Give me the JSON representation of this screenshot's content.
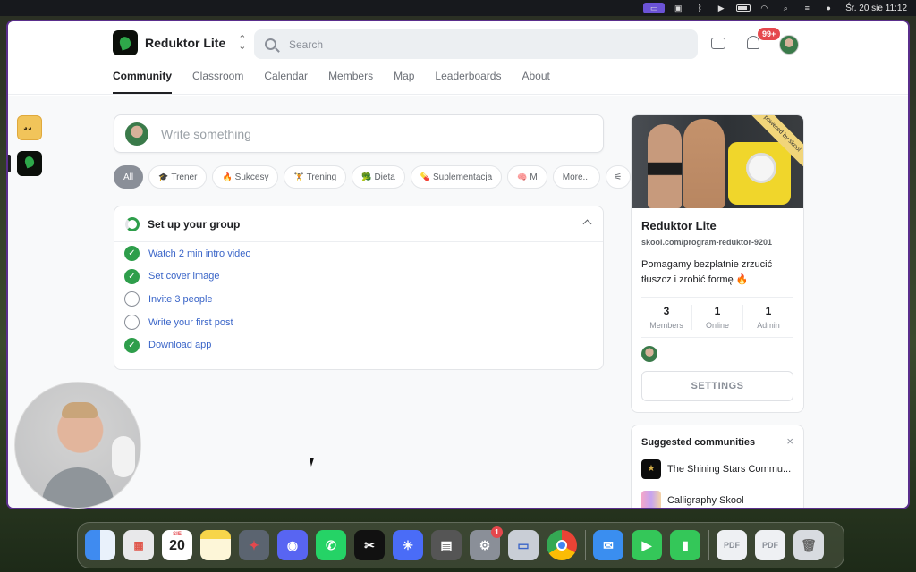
{
  "menubar": {
    "date_time": "Śr. 20 sie  11:12"
  },
  "header": {
    "group_name": "Reduktor Lite",
    "search_placeholder": "Search",
    "notification_count": "99+",
    "tabs": [
      {
        "label": "Community",
        "active": true
      },
      {
        "label": "Classroom",
        "active": false
      },
      {
        "label": "Calendar",
        "active": false
      },
      {
        "label": "Members",
        "active": false
      },
      {
        "label": "Map",
        "active": false
      },
      {
        "label": "Leaderboards",
        "active": false
      },
      {
        "label": "About",
        "active": false
      }
    ]
  },
  "compose": {
    "placeholder": "Write something"
  },
  "filters": {
    "chips": [
      {
        "label": "All",
        "emoji": "",
        "active": true
      },
      {
        "label": "Trener",
        "emoji": "🎓"
      },
      {
        "label": "Sukcesy",
        "emoji": "🔥"
      },
      {
        "label": "Trening",
        "emoji": "🏋"
      },
      {
        "label": "Dieta",
        "emoji": "🥦"
      },
      {
        "label": "Suplementacja",
        "emoji": "💊"
      },
      {
        "label": "M",
        "emoji": "🧠"
      },
      {
        "label": "More...",
        "emoji": ""
      }
    ]
  },
  "setup": {
    "title": "Set up your group",
    "tasks": [
      {
        "label": "Watch 2 min intro video",
        "done": true
      },
      {
        "label": "Set cover image",
        "done": true
      },
      {
        "label": "Invite 3 people",
        "done": false
      },
      {
        "label": "Write your first post",
        "done": false
      },
      {
        "label": "Download app",
        "done": true
      }
    ]
  },
  "group_card": {
    "powered_by": "powered by skool",
    "name": "Reduktor Lite",
    "url": "skool.com/program-reduktor-9201",
    "description": "Pomagamy bezpłatnie zrzucić tłuszcz i zrobić formę 🔥",
    "stats": [
      {
        "value": "3",
        "label": "Members"
      },
      {
        "value": "1",
        "label": "Online"
      },
      {
        "value": "1",
        "label": "Admin"
      }
    ],
    "settings_label": "SETTINGS"
  },
  "suggested": {
    "title": "Suggested communities",
    "close": "×",
    "items": [
      {
        "label": "The Shining Stars Commu..."
      },
      {
        "label": "Calligraphy Skool"
      }
    ]
  },
  "dock": {
    "calendar_month": "SIE",
    "calendar_day": "20",
    "settings_badge": "1"
  },
  "colors": {
    "accent_green": "#2e9e4b",
    "link_blue": "#3a65c8",
    "badge_red": "#e5484d"
  }
}
